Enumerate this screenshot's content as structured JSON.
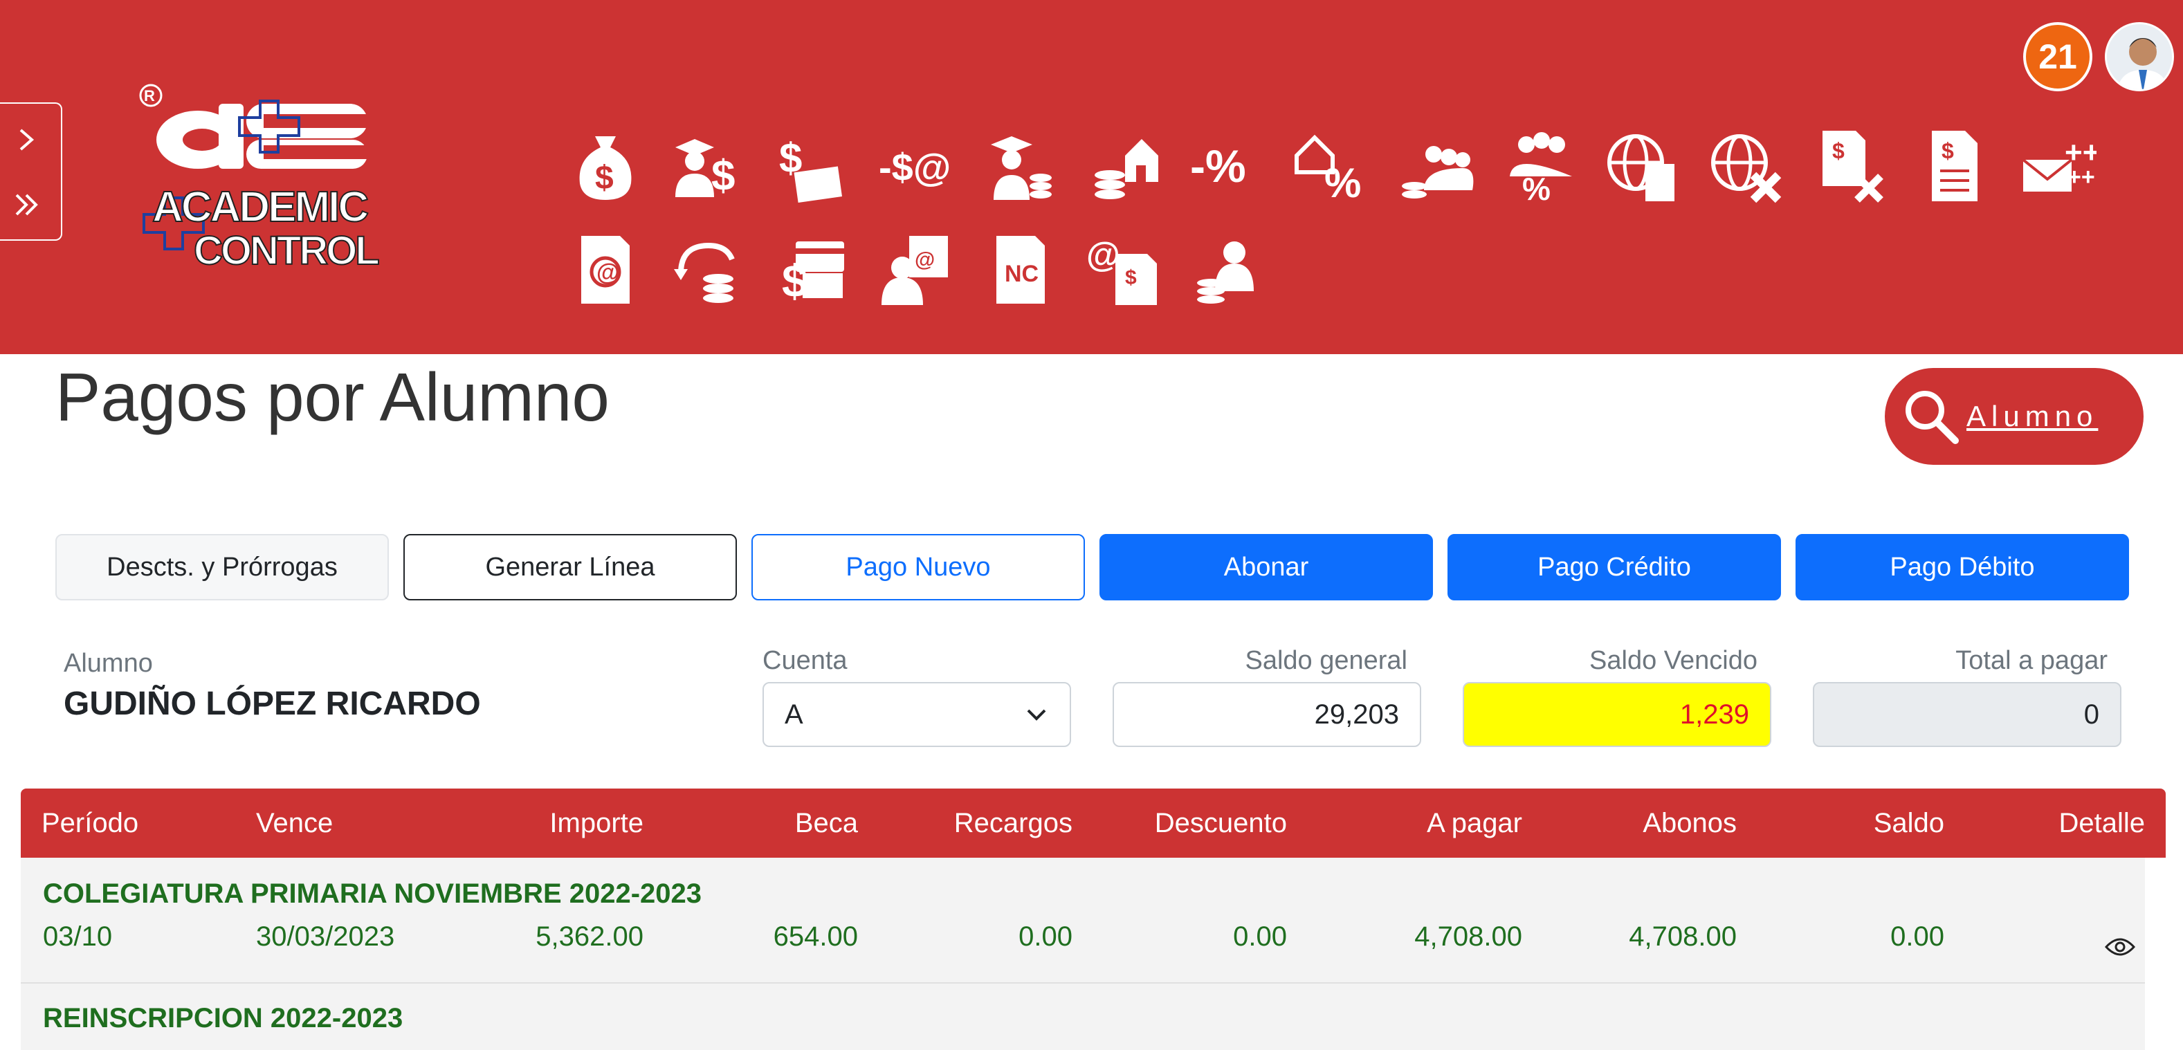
{
  "header": {
    "notification_count": "21",
    "colors": {
      "brand": "#cc3333",
      "badge": "#ee6611"
    },
    "logo": {
      "registered": "®",
      "mark": "a+c",
      "line1": "ACADEMIC",
      "line2": "+CONTROL"
    },
    "toolbar_icons_row1": [
      "money-bag-icon",
      "students-money-icon",
      "document-money-icon",
      "email-money-icon",
      "graduate-coins-icon",
      "house-coins-icon",
      "minus-percent-icon",
      "house-percent-icon",
      "group-coins-icon",
      "group-percent-icon",
      "globe-document-icon",
      "globe-cancel-icon",
      "document-money-cancel-icon",
      "money-document-icon",
      "email-sparkle-icon"
    ],
    "toolbar_icons_row2": [
      "email-document-icon",
      "refund-coins-icon",
      "card-money-icon",
      "person-email-icon",
      "nc-document-icon",
      "email-money-document-icon",
      "person-coins-icon"
    ]
  },
  "page": {
    "title": "Pagos por Alumno",
    "search_label": "Alumno"
  },
  "actions": {
    "descuentos": "Descts. y Prórrogas",
    "generar_linea": "Generar Línea",
    "pago_nuevo": "Pago Nuevo",
    "abonar": "Abonar",
    "pago_credito": "Pago Crédito",
    "pago_debito": "Pago Débito"
  },
  "student": {
    "label": "Alumno",
    "name": "GUDIÑO LÓPEZ RICARDO",
    "cuenta_label": "Cuenta",
    "cuenta_value": "A",
    "saldo_general_label": "Saldo general",
    "saldo_general": "29,203",
    "saldo_vencido_label": "Saldo Vencido",
    "saldo_vencido": "1,239",
    "total_pagar_label": "Total a pagar",
    "total_pagar": "0"
  },
  "table": {
    "columns": [
      "Período",
      "Vence",
      "Importe",
      "Beca",
      "Recargos",
      "Descuento",
      "A pagar",
      "Abonos",
      "Saldo",
      "Detalle"
    ],
    "groups": [
      {
        "title": "COLEGIATURA PRIMARIA NOVIEMBRE 2022-2023",
        "row": [
          "03/10",
          "30/03/2023",
          "5,362.00",
          "654.00",
          "0.00",
          "0.00",
          "4,708.00",
          "4,708.00",
          "0.00"
        ]
      },
      {
        "title": "REINSCRIPCION 2022-2023"
      }
    ]
  }
}
